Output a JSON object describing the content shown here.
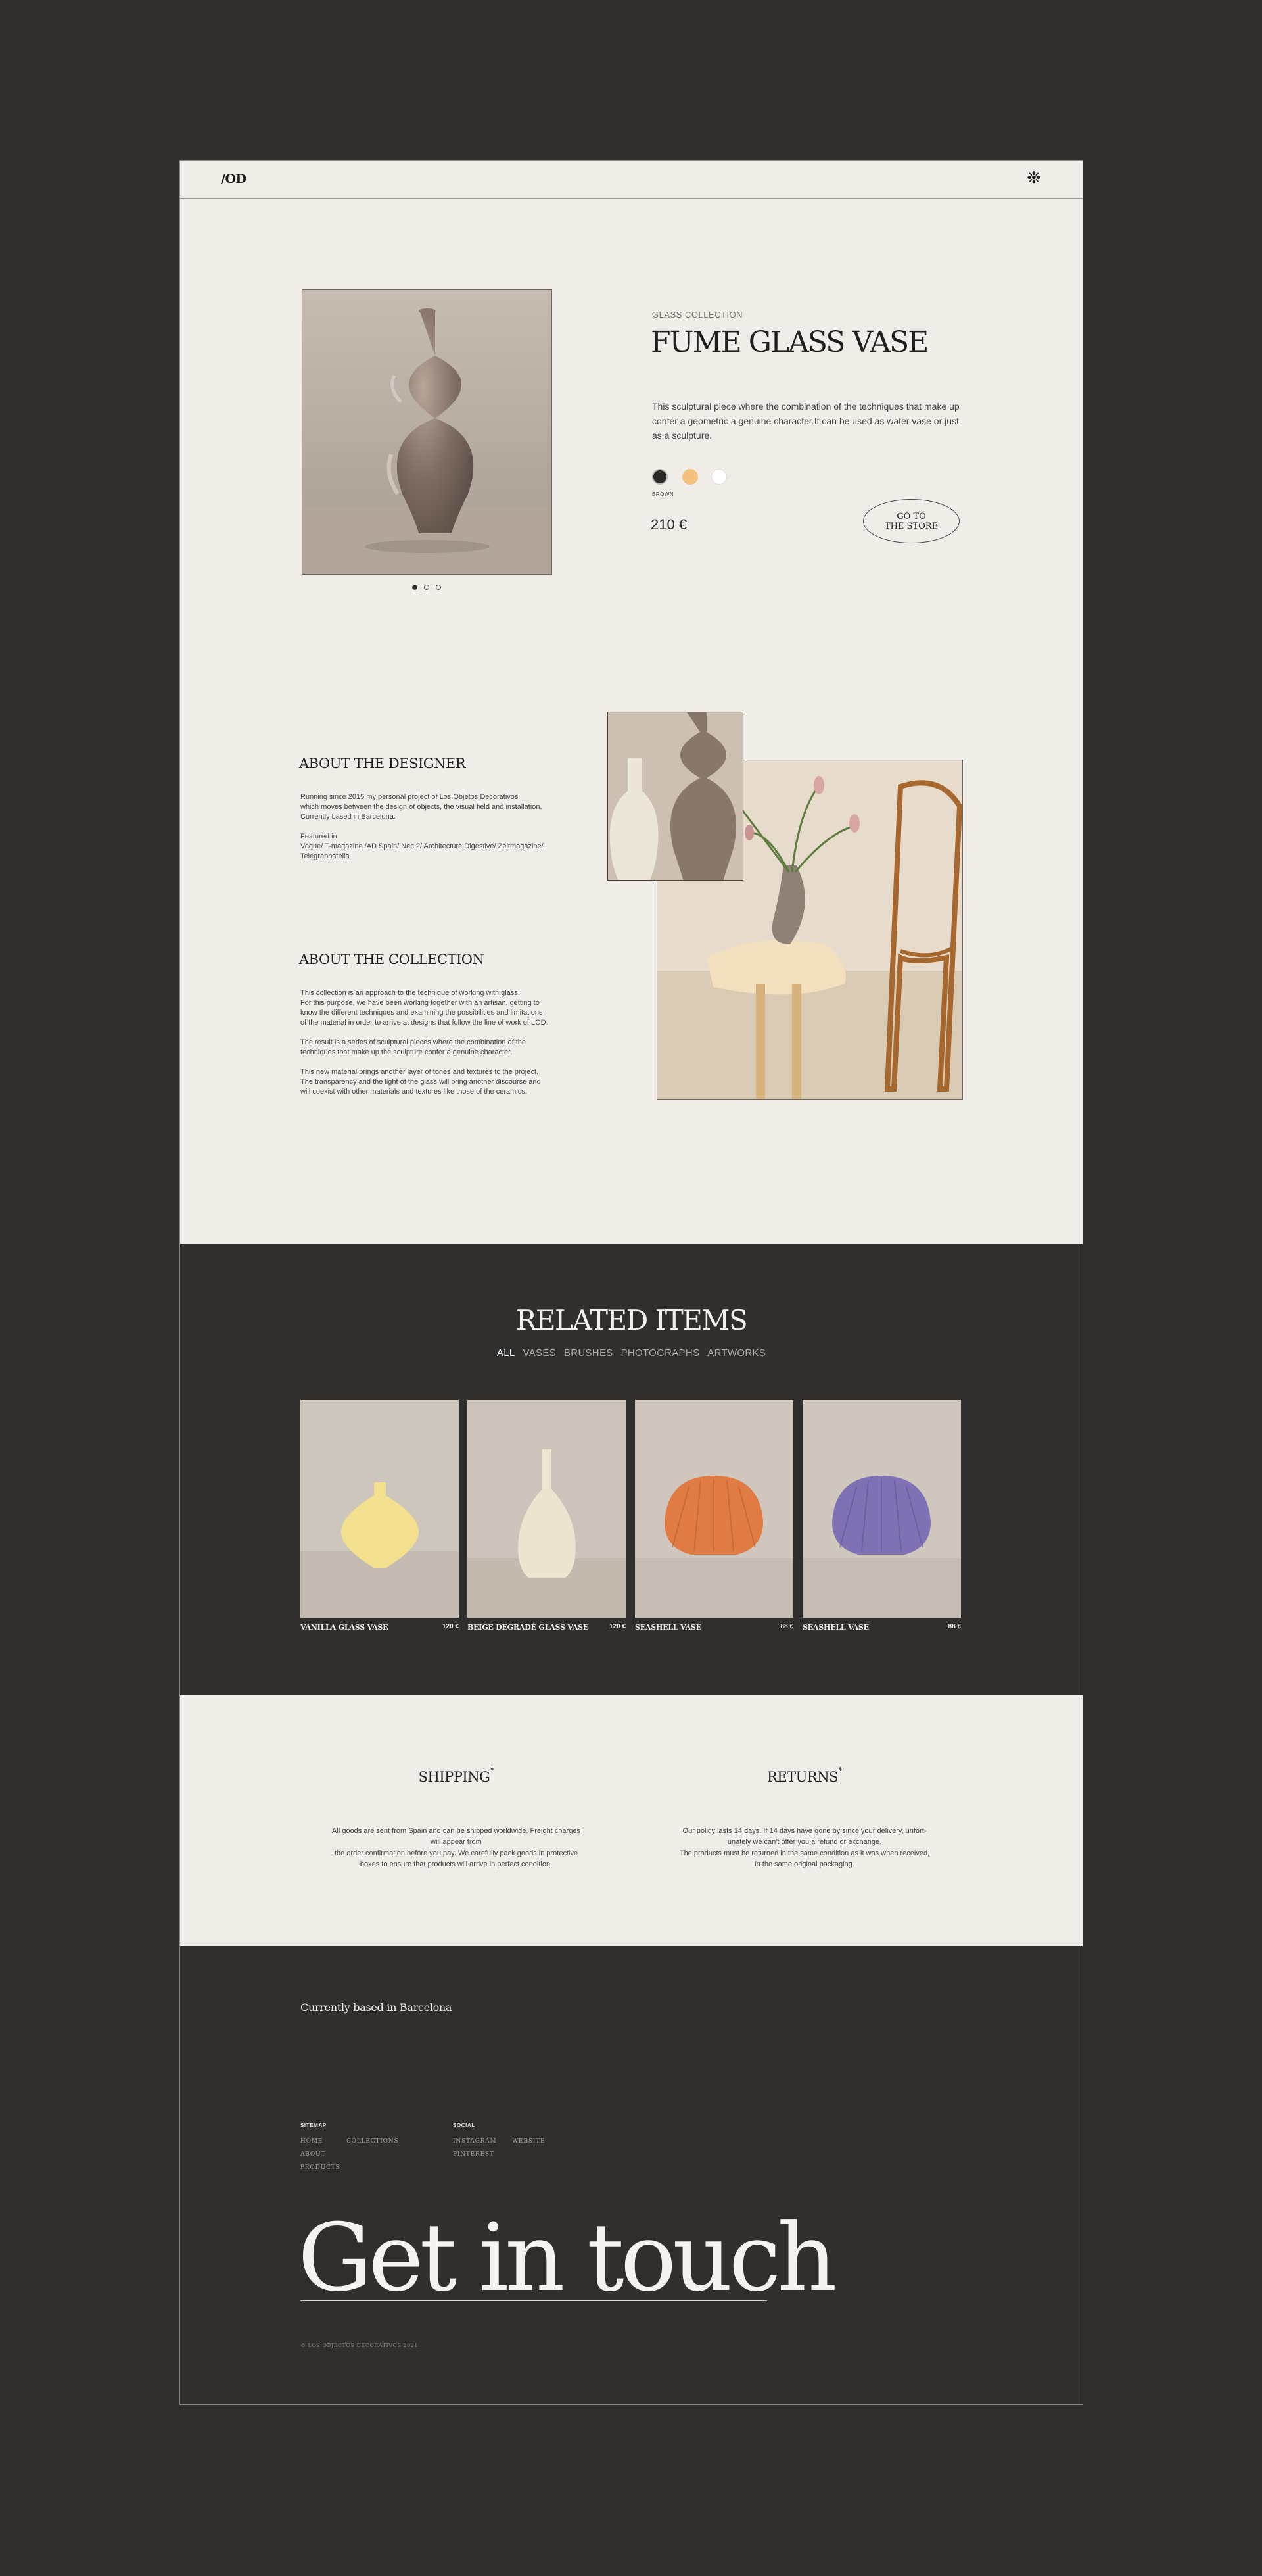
{
  "header": {
    "logo": "/OD",
    "menu_icon": "asterisk-icon"
  },
  "product": {
    "collection": "GLASS COLLECTION",
    "title": "FUME GLASS VASE",
    "description": "This sculptural piece where the combination of the techniques that make up confer a geometric a genuine character.It can be used as water vase or just as a sculpture.",
    "swatches": [
      {
        "name": "BROWN",
        "color": "#2b2725",
        "selected": true
      },
      {
        "name": "AMBER",
        "color": "#f3c07e",
        "selected": false
      },
      {
        "name": "WHITE",
        "color": "#ffffff",
        "selected": false
      }
    ],
    "selected_color": "BROWN",
    "price": "210 €",
    "store_button": "GO TO\nTHE STORE",
    "carousel": {
      "count": 3,
      "active": 1
    }
  },
  "designer": {
    "title": "ABOUT THE DESIGNER",
    "text": "Running since 2015 my personal project of Los Objetos Decorativos\nwhich moves between the design of objects, the visual field and installation.\nCurrently based in Barcelona.\n\nFeatured in\nVogue/ T-magazine /AD Spain/ Nec 2/ Architecture Digestive/ Zeitmagazine/\nTelegraphatelia"
  },
  "collection": {
    "title": "ABOUT THE COLLECTION",
    "text": "This collection is an approach to the technique of working with glass.\nFor this purpose, we have been working together with an artisan, getting to\nknow the different techniques and examining the possibilities and limitations\nof the material in order to arrive at designs that follow the line of work of LOD.\n\nThe result is a series of sculptural pieces where the combination of the\ntechniques that make up the sculpture confer a genuine character.\n\nThis new material brings another layer of tones and textures to the project.\nThe transparency and the light of the glass will bring another discourse and\nwill coexist with other materials and textures like those of the ceramics."
  },
  "related": {
    "title": "RELATED ITEMS",
    "filters": [
      "ALL",
      "VASES",
      "BRUSHES",
      "PHOTOGRAPHS",
      "ARTWORKS"
    ],
    "active_filter": "ALL",
    "items": [
      {
        "name": "VANILLA GLASS VASE",
        "price": "120 €",
        "color": "#f2e08f"
      },
      {
        "name": "BEIGE DEGRADÉ GLASS VASE",
        "price": "120 €",
        "color": "#ece4cf"
      },
      {
        "name": "SEASHELL VASE",
        "price": "88 €",
        "color": "#e07b43"
      },
      {
        "name": "SEASHELL VASE",
        "price": "88 €",
        "color": "#7f72b4"
      }
    ]
  },
  "shipping": {
    "title": "SHIPPING",
    "mark": "*",
    "text": "All goods are sent from Spain and can be shipped worldwide. Freight charges\nwill appear from\nthe order confirmation before you pay. We carefully pack goods in protective\nboxes to ensure that products will arrive in perfect condition."
  },
  "returns": {
    "title": "RETURNS",
    "mark": "*",
    "text": "Our policy lasts 14 days. If 14 days have gone by since your delivery, unfort-\nunately we can't offer you a refund or exchange.\nThe products must be returned in the same condition as it was when received,\nin the same original packaging."
  },
  "footer": {
    "location": "Currently based in Barcelona",
    "sitemap_title": "SITEMAP",
    "sitemap_links": [
      "HOME",
      "COLLECTIONS",
      "ABOUT",
      "PRODUCTS"
    ],
    "social_title": "SOCIAL",
    "social_links": [
      "INSTAGRAM",
      "WEBSITE",
      "PINTEREST"
    ],
    "cta": "Get in touch",
    "copyright": "©  LOS OBJECTOS DECORATIVOS 2021"
  }
}
